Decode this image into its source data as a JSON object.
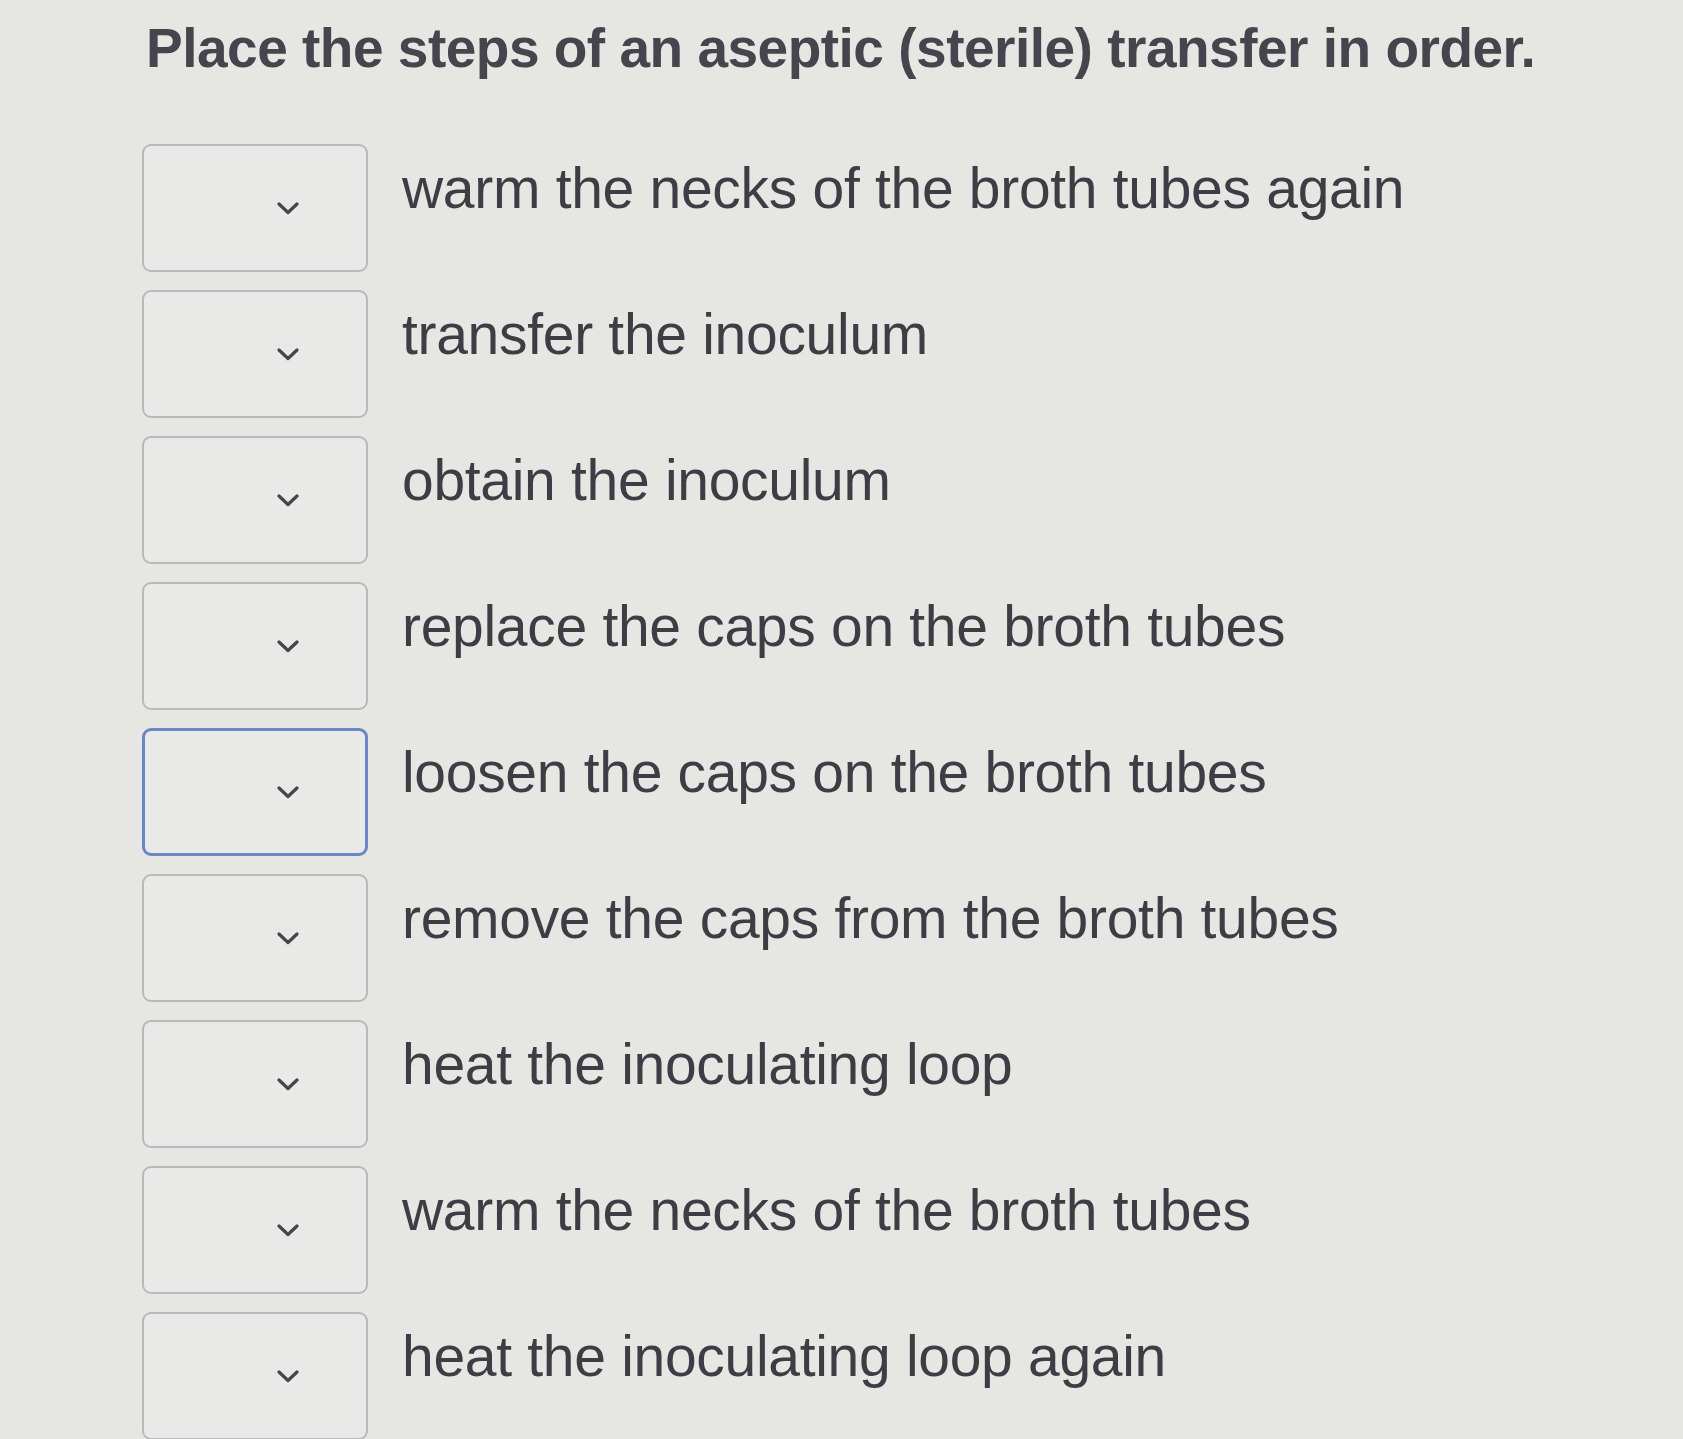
{
  "question": {
    "title": "Place the steps of an aseptic (sterile) transfer in order."
  },
  "steps": [
    {
      "text": "warm the necks of the broth tubes again",
      "focused": false
    },
    {
      "text": "transfer the inoculum",
      "focused": false
    },
    {
      "text": "obtain the inoculum",
      "focused": false
    },
    {
      "text": "replace the caps on the broth tubes",
      "focused": false
    },
    {
      "text": "loosen the caps on the broth tubes",
      "focused": true
    },
    {
      "text": "remove the caps from the broth tubes",
      "focused": false
    },
    {
      "text": "heat the inoculating loop",
      "focused": false
    },
    {
      "text": "warm the necks of the broth tubes",
      "focused": false
    },
    {
      "text": "heat the inoculating loop again",
      "focused": false
    }
  ]
}
